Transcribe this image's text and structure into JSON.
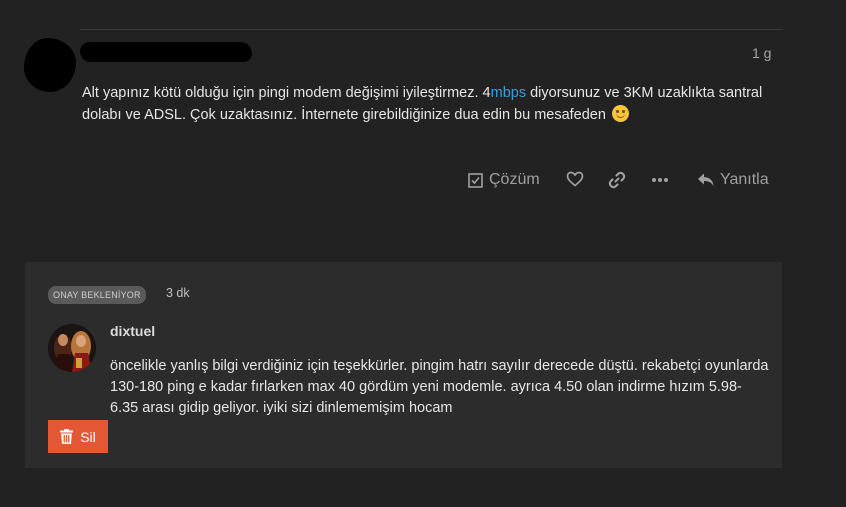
{
  "post": {
    "age": "1 g",
    "body_part1": "Alt yapınız kötü olduğu için pingi modem değişimi iyileştirmez. 4",
    "body_link": "mbps",
    "body_part2": " diyorsunuz ve 3KM uzaklıkta santral dolabı ve ADSL. Çok uzaktasınız. İnternete girebildiğinize dua edin bu mesafeden",
    "emoji": "slight-smile"
  },
  "actions": {
    "solution_label": "Çözüm",
    "reply_label": "Yanıtla"
  },
  "pending": {
    "badge": "ONAY BEKLENİYOR",
    "age": "3 dk",
    "username": "dixtuel",
    "body": "öncelikle yanlış bilgi verdiğiniz için teşekkürler. pingim hatrı sayılır derecede düştü. rekabetçi oyunlarda 130-180 ping e kadar fırlarken max 40 gördüm yeni modemle. ayrıca 4.50 olan indirme hızım 5.98-6.35 arası gidip geliyor. iyiki sizi dinlememişim hocam",
    "delete_label": "Sil"
  },
  "colors": {
    "background": "#222222",
    "card": "#2c2c2c",
    "danger": "#e45735",
    "link": "#3d9fd9"
  }
}
